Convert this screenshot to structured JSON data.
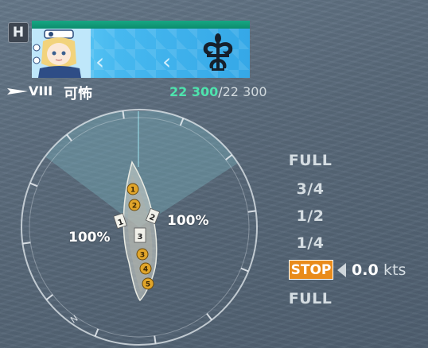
{
  "hotkey": {
    "label": "H"
  },
  "ship": {
    "tier": "VIII",
    "name": "可怖",
    "hp_current": "22 300",
    "hp_separator": "/",
    "hp_max": "22 300",
    "health_fraction": 1.0
  },
  "rudder_display": {
    "left_percent_label": "100%",
    "right_percent_label": "100%",
    "compass_mark": "N",
    "turrets": [
      "1",
      "2",
      "3",
      "4",
      "5"
    ],
    "secondary_markers": [
      "2",
      "1"
    ],
    "rear_marker": "3"
  },
  "throttle": {
    "levels": [
      "FULL",
      "3/4",
      "1/2",
      "1/4",
      "STOP",
      "FULL"
    ],
    "selected": "STOP",
    "speed_value": "0.0",
    "speed_unit": "kts"
  },
  "colors": {
    "hp_green": "#4ee3ad",
    "health_bar": "#17a784",
    "stop_orange": "#e98b1a",
    "turret_gold": "#e0a52a",
    "banner_blue": "#46b8ef"
  },
  "icons": {
    "hotkey": "keyboard-key-icon",
    "ship_class": "battleship-class-icon",
    "faction_emblem": "fleur-emblem-icon",
    "avatar": "commander-avatar-icon"
  }
}
